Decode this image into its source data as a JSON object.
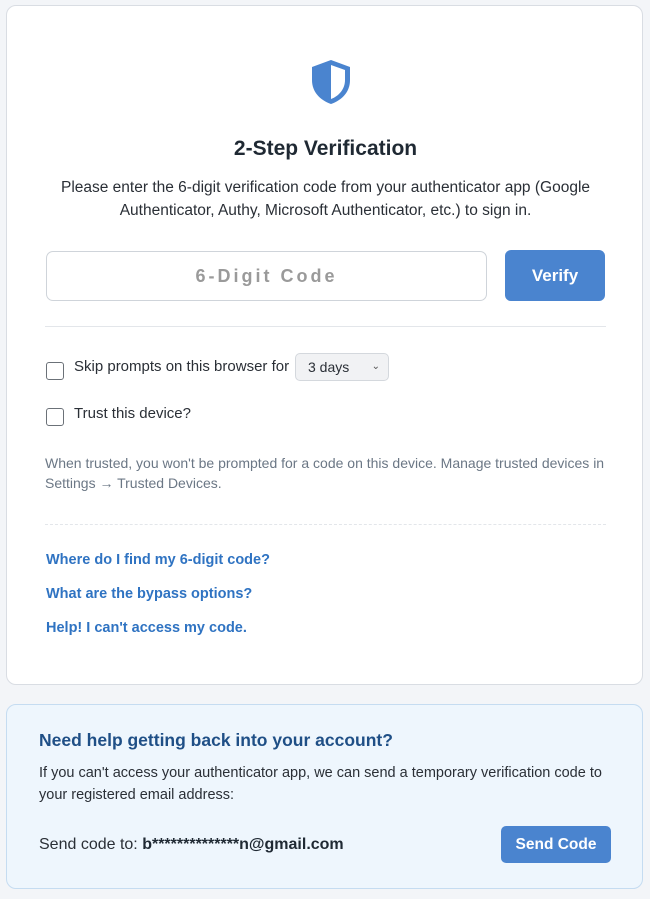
{
  "verify": {
    "title": "2-Step Verification",
    "subtitle": "Please enter the 6-digit verification code from your authenticator app (Google Authenticator, Authy, Microsoft Authenticator, etc.) to sign in.",
    "code_input": {
      "placeholder": "6-Digit Code",
      "value": ""
    },
    "verify_label": "Verify",
    "shield_icon": "shield-icon",
    "accent_color": "#4a84cf"
  },
  "options": {
    "skip_label": "Skip prompts on this browser for",
    "skip_duration": "3 days",
    "trust_label": "Trust this device?",
    "trust_note": "When trusted, you won't be prompted for a code on this device. Manage trusted devices in Settings → Trusted Devices."
  },
  "links": [
    "Where do I find my 6-digit code?",
    "What are the bypass options?",
    "Help! I can't access my code."
  ],
  "recovery": {
    "title": "Need help getting back into your account?",
    "text": "If you can't access your authenticator app, we can send a temporary verification code to your registered email address:",
    "send_to_label": "Send code to:",
    "email": "b**************n@gmail.com",
    "send_label": "Send Code"
  }
}
